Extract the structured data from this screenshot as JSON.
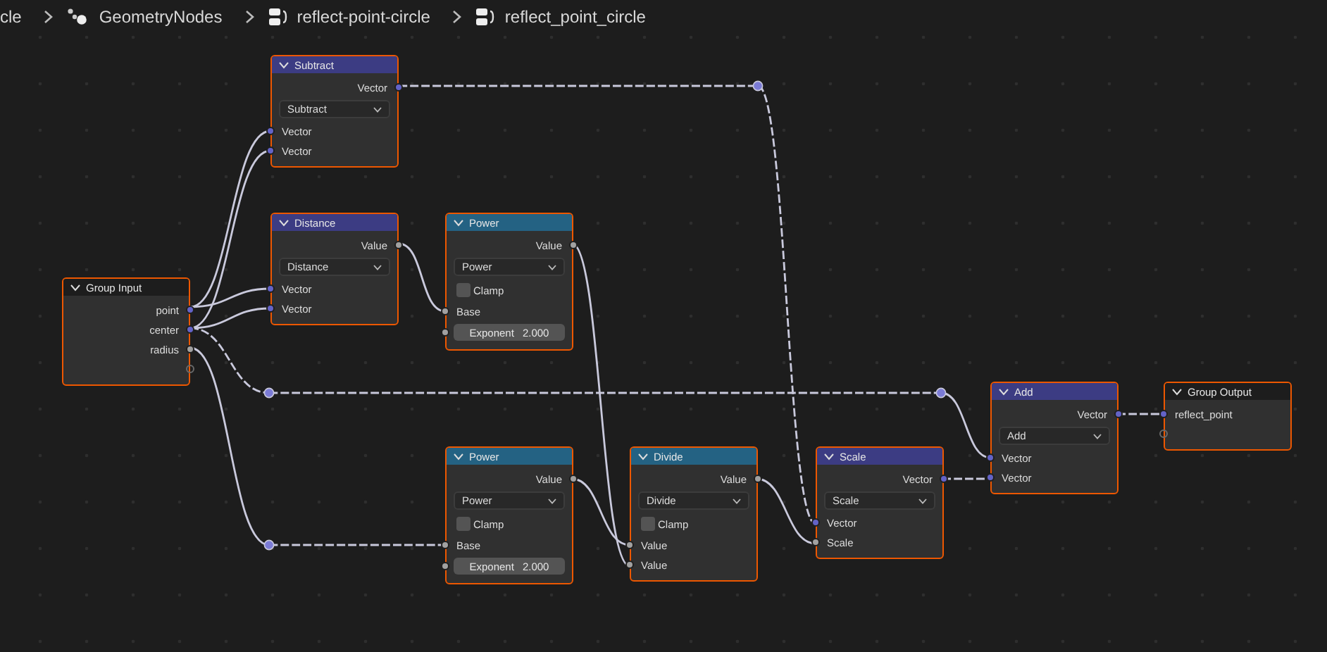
{
  "breadcrumb": [
    {
      "text": "cle"
    },
    {
      "text": "GeometryNodes"
    },
    {
      "text": "reflect-point-circle"
    },
    {
      "text": "reflect_point_circle"
    }
  ],
  "nodes": [
    {
      "title": "Subtract",
      "color": "#3c3c83",
      "selected": true,
      "rows": [
        {
          "kind": "output",
          "label": "Vector",
          "color": "#6363c7"
        },
        {
          "kind": "select",
          "value": "Subtract"
        },
        {
          "kind": "input",
          "label": "Vector",
          "color": "#6363c7"
        },
        {
          "kind": "input",
          "label": "Vector",
          "color": "#6363c7"
        }
      ]
    },
    {
      "title": "Distance",
      "color": "#3c3c83",
      "selected": true,
      "rows": [
        {
          "kind": "output",
          "label": "Value",
          "color": "#a1a1a1"
        },
        {
          "kind": "select",
          "value": "Distance"
        },
        {
          "kind": "input",
          "label": "Vector",
          "color": "#6363c7"
        },
        {
          "kind": "input",
          "label": "Vector",
          "color": "#6363c7"
        }
      ]
    },
    {
      "title": "Power",
      "color": "#246283",
      "selected": true,
      "rows": [
        {
          "kind": "output",
          "label": "Value",
          "color": "#a1a1a1"
        },
        {
          "kind": "select",
          "value": "Power"
        },
        {
          "kind": "checkbox",
          "label": "Clamp",
          "checked": false
        },
        {
          "kind": "input",
          "label": "Base",
          "color": "#a1a1a1"
        },
        {
          "kind": "field",
          "label": "Exponent",
          "value": "2.000",
          "color": "#a1a1a1"
        }
      ]
    },
    {
      "title": "Group Input",
      "color": "#1d1d1d",
      "selected": true,
      "rows": [
        {
          "kind": "output",
          "label": "point",
          "color": "#6363c7"
        },
        {
          "kind": "output",
          "label": "center",
          "color": "#6363c7"
        },
        {
          "kind": "output",
          "label": "radius",
          "color": "#a1a1a1"
        },
        {
          "kind": "empty-output"
        }
      ]
    },
    {
      "title": "Add",
      "color": "#3c3c83",
      "selected": true,
      "rows": [
        {
          "kind": "output",
          "label": "Vector",
          "color": "#6363c7"
        },
        {
          "kind": "select",
          "value": "Add"
        },
        {
          "kind": "input",
          "label": "Vector",
          "color": "#6363c7"
        },
        {
          "kind": "input",
          "label": "Vector",
          "color": "#6363c7"
        }
      ]
    },
    {
      "title": "Group Output",
      "color": "#1d1d1d",
      "selected": true,
      "rows": [
        {
          "kind": "input",
          "label": "reflect_point",
          "color": "#6363c7"
        },
        {
          "kind": "empty-input"
        }
      ]
    },
    {
      "title": "Power",
      "color": "#246283",
      "selected": true,
      "rows": [
        {
          "kind": "output",
          "label": "Value",
          "color": "#a1a1a1"
        },
        {
          "kind": "select",
          "value": "Power"
        },
        {
          "kind": "checkbox",
          "label": "Clamp",
          "checked": false
        },
        {
          "kind": "input",
          "label": "Base",
          "color": "#a1a1a1"
        },
        {
          "kind": "field",
          "label": "Exponent",
          "value": "2.000",
          "color": "#a1a1a1"
        }
      ]
    },
    {
      "title": "Divide",
      "color": "#246283",
      "selected": true,
      "rows": [
        {
          "kind": "output",
          "label": "Value",
          "color": "#a1a1a1"
        },
        {
          "kind": "select",
          "value": "Divide"
        },
        {
          "kind": "checkbox",
          "label": "Clamp",
          "checked": false
        },
        {
          "kind": "input",
          "label": "Value",
          "color": "#a1a1a1"
        },
        {
          "kind": "input",
          "label": "Value",
          "color": "#a1a1a1"
        }
      ]
    },
    {
      "title": "Scale",
      "color": "#3c3c83",
      "selected": true,
      "rows": [
        {
          "kind": "output",
          "label": "Vector",
          "color": "#6363c7"
        },
        {
          "kind": "select",
          "value": "Scale"
        },
        {
          "kind": "input",
          "label": "Vector",
          "color": "#6363c7"
        },
        {
          "kind": "input",
          "label": "Scale",
          "color": "#a1a1a1"
        }
      ]
    }
  ]
}
